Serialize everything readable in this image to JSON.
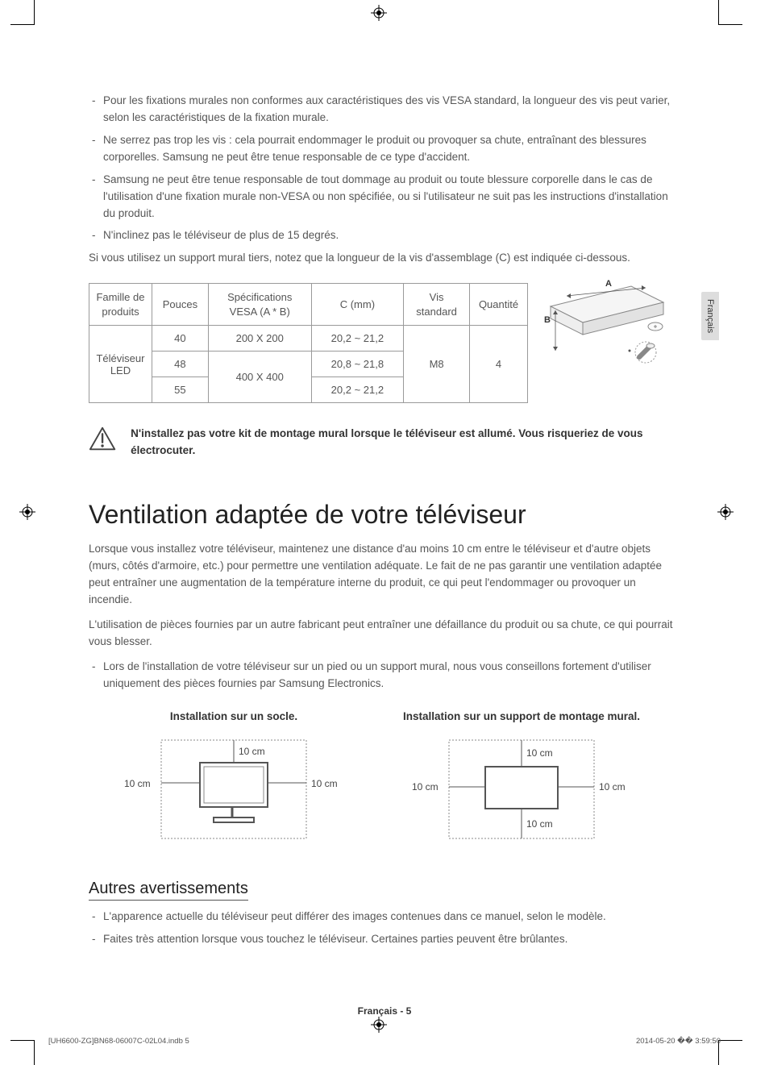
{
  "bullets_top": [
    "Pour les fixations murales non conformes aux caractéristiques des vis VESA standard, la longueur des vis peut varier, selon les caractéristiques de la fixation murale.",
    "Ne serrez pas trop les vis : cela pourrait endommager le produit ou provoquer sa chute, entraînant des blessures corporelles. Samsung ne peut être tenue responsable de ce type d'accident.",
    "Samsung ne peut être tenue responsable de tout dommage au produit ou toute blessure corporelle dans le cas de l'utilisation d'une fixation murale non-VESA ou non spécifiée, ou si l'utilisateur ne suit pas les instructions d'installation du produit.",
    "N'inclinez pas le téléviseur de plus de 15 degrés."
  ],
  "intro_after_bullets": "Si vous utilisez un support mural tiers, notez que la longueur de la vis d'assemblage (C) est indiquée ci-dessous.",
  "table": {
    "headers": {
      "family": "Famille de produits",
      "inches": "Pouces",
      "vesa": "Spécifications VESA (A * B)",
      "c": "C (mm)",
      "screw": "Vis standard",
      "qty": "Quantité"
    },
    "family_value": "Téléviseur LED",
    "rows": [
      {
        "inches": "40",
        "vesa": "200 X 200",
        "c": "20,2 ~ 21,2"
      },
      {
        "inches": "48",
        "vesa": "400 X 400",
        "c": "20,8 ~ 21,8"
      },
      {
        "inches": "55",
        "vesa": "400 X 400",
        "c": "20,2 ~ 21,2"
      }
    ],
    "screw_value": "M8",
    "qty_value": "4",
    "diagram_labels": {
      "A": "A",
      "B": "B"
    }
  },
  "warning": "N'installez pas votre kit de montage mural lorsque le téléviseur est allumé. Vous risqueriez de vous électrocuter.",
  "section_title": "Ventilation adaptée de votre téléviseur",
  "ventilation_paragraphs": [
    "Lorsque vous installez votre téléviseur, maintenez une distance d'au moins 10 cm entre le téléviseur et d'autre objets (murs, côtés d'armoire, etc.) pour permettre une ventilation adéquate. Le fait de ne pas garantir une ventilation adaptée peut entraîner une augmentation de la température interne du produit, ce qui peut l'endommager ou provoquer un incendie.",
    "L'utilisation de pièces fournies par un autre fabricant peut entraîner une défaillance du produit ou sa chute, ce qui pourrait vous blesser."
  ],
  "ventilation_bullet": "Lors de l'installation de votre téléviseur sur un pied ou un support mural, nous vous conseillons fortement d'utiliser uniquement des pièces fournies par Samsung Electronics.",
  "install": {
    "stand_title": "Installation sur un socle.",
    "wall_title": "Installation sur un support de montage mural.",
    "dist": "10 cm"
  },
  "other_warnings_title": "Autres avertissements",
  "other_warnings": [
    "L'apparence actuelle du téléviseur peut différer des images contenues dans ce manuel, selon le modèle.",
    "Faites très attention lorsque vous touchez le téléviseur. Certaines parties peuvent être brûlantes."
  ],
  "page_footer": "Français - 5",
  "file_footer_left": "[UH6600-ZG]BN68-06007C-02L04.indb   5",
  "file_footer_right": "2014-05-20   �� 3:59:50",
  "side_tab": "Français"
}
